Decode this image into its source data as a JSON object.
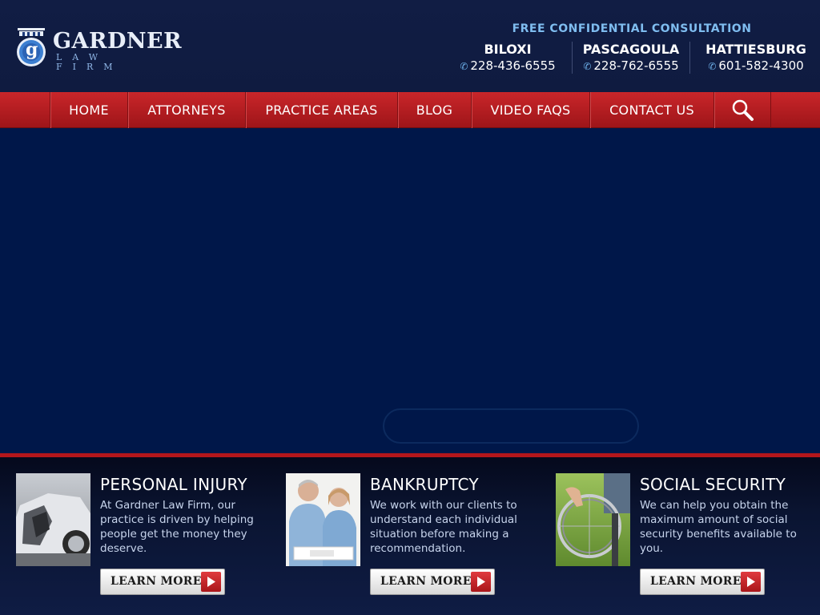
{
  "header": {
    "logo": {
      "name": "GARDNER",
      "sub": "LAW FIRM",
      "emblem_letter": "g"
    },
    "consultation": "FREE CONFIDENTIAL CONSULTATION",
    "offices": [
      {
        "city": "BILOXI",
        "phone": "228-436-6555"
      },
      {
        "city": "PASCAGOULA",
        "phone": "228-762-6555"
      },
      {
        "city": "HATTIESBURG",
        "phone": "601-582-4300"
      }
    ]
  },
  "nav": {
    "items": [
      {
        "label": "HOME"
      },
      {
        "label": "ATTORNEYS"
      },
      {
        "label": "PRACTICE AREAS"
      },
      {
        "label": "BLOG"
      },
      {
        "label": "VIDEO FAQS"
      },
      {
        "label": "CONTACT US"
      }
    ],
    "search_icon": "magnifier-icon"
  },
  "services": [
    {
      "title": "PERSONAL INJURY",
      "text": "At Gardner Law Firm, our practice is driven by helping people get the money they deserve.",
      "button": "LEARN MORE"
    },
    {
      "title": "BANKRUPTCY",
      "text": "We work with our clients to understand each individual situation before making a recommendation.",
      "button": "LEARN MORE"
    },
    {
      "title": "SOCIAL SECURITY",
      "text": "We can help you obtain the maximum amount of social security benefits available to you.",
      "button": "LEARN MORE"
    }
  ],
  "colors": {
    "header_bg": "#111d44",
    "nav_red": "#b81e22",
    "hero_bg": "#001749",
    "consult_blue": "#7fbdf0"
  }
}
